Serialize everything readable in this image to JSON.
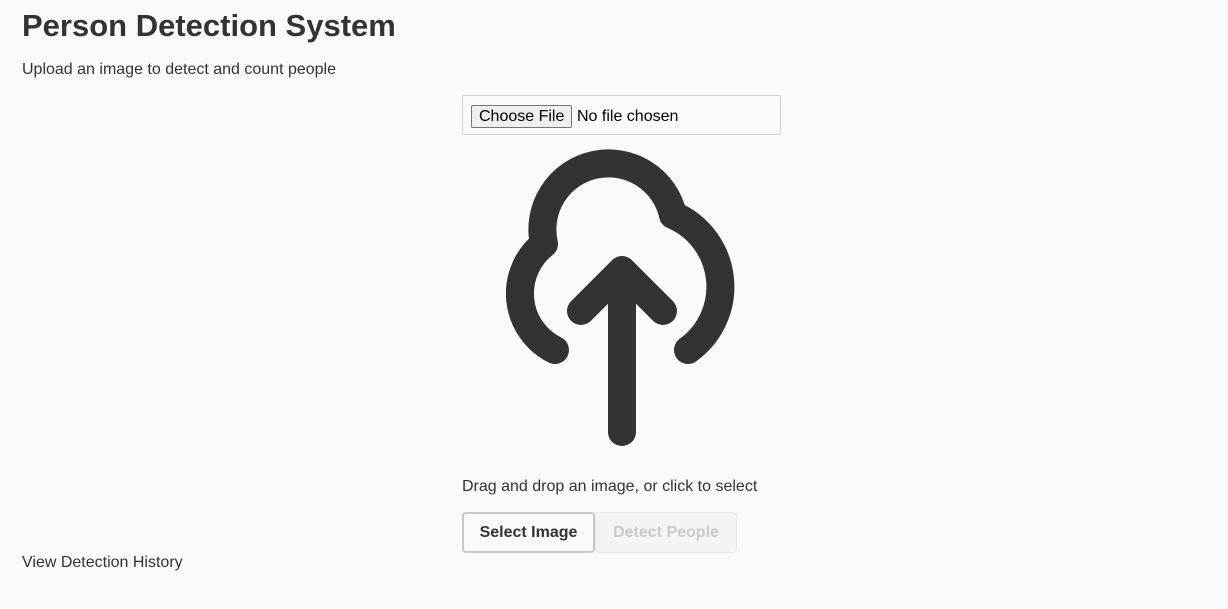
{
  "header": {
    "title": "Person Detection System",
    "subtitle": "Upload an image to detect and count people"
  },
  "upload": {
    "file_input": {
      "button_label": "Choose File",
      "status_text": "No file chosen"
    },
    "icon": "cloud-upload-icon",
    "drop_text": "Drag and drop an image, or click to select",
    "select_button": "Select Image",
    "detect_button": "Detect People",
    "detect_button_disabled": true
  },
  "footer": {
    "history_link": "View Detection History"
  },
  "colors": {
    "background": "#f9fafb",
    "text": "#333333",
    "icon": "#333333",
    "disabled_text": "#c7c9cd"
  }
}
